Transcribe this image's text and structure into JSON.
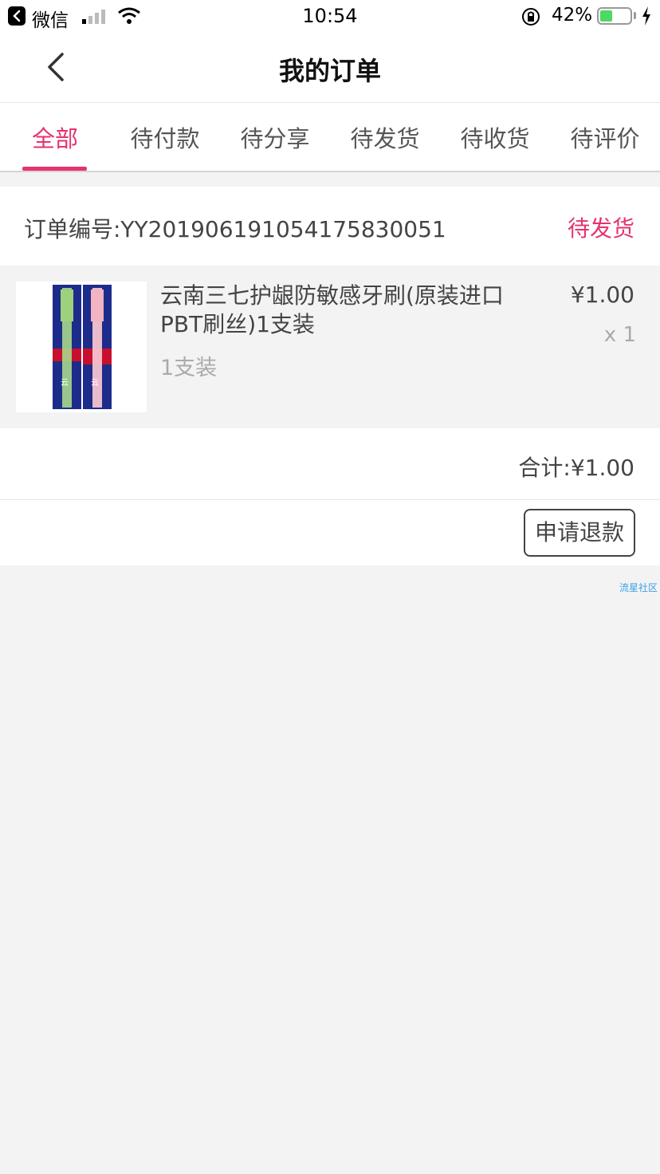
{
  "status_bar": {
    "back_app": "微信",
    "time": "10:54",
    "battery_percent": "42%",
    "battery_level": 0.42
  },
  "header": {
    "title": "我的订单"
  },
  "tabs": [
    {
      "label": "全部",
      "active": true
    },
    {
      "label": "待付款",
      "active": false
    },
    {
      "label": "待分享",
      "active": false
    },
    {
      "label": "待发货",
      "active": false
    },
    {
      "label": "待收货",
      "active": false
    },
    {
      "label": "待评价",
      "active": false
    }
  ],
  "order": {
    "number": "订单编号:YY20190619105417583005​1",
    "status": "待发货",
    "item": {
      "name": "云南三七护龈防敏感牙刷(原装进口PBT刷丝)1支装",
      "spec": "1支装",
      "price": "¥1.00",
      "quantity": "x 1"
    },
    "total": "合计:¥1.00",
    "refund_button": "申请退款"
  },
  "watermark": "流星社区",
  "colors": {
    "accent": "#e5336d",
    "background": "#f3f3f3"
  }
}
